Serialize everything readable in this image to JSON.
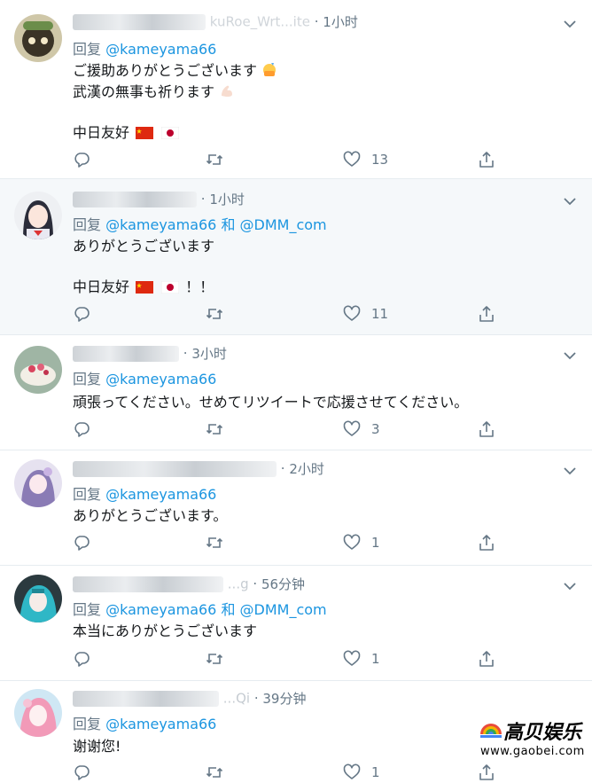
{
  "tweets": [
    {
      "name": "kuRoe_Wrt...ite",
      "time": "1小时",
      "reply_prefix": "回复",
      "mentions": "@kameyama66",
      "lines": [
        "ご援助ありがとうございます",
        "武漢の無事も祈ります",
        "",
        "中日友好"
      ],
      "likes": "13"
    },
    {
      "name": "...",
      "time": "1小时",
      "reply_prefix": "回复",
      "mentions": "@kameyama66 和 @DMM_com",
      "lines": [
        "ありがとうございます",
        "",
        "中日友好",
        "！！"
      ],
      "likes": "11"
    },
    {
      "name": "...",
      "time": "3小时",
      "reply_prefix": "回复",
      "mentions": "@kameyama66",
      "lines": [
        "頑張ってください。せめてリツイートで応援させてください。"
      ],
      "likes": "3"
    },
    {
      "name": "...",
      "time": "2小时",
      "reply_prefix": "回复",
      "mentions": "@kameyama66",
      "lines": [
        "ありがとうございます。"
      ],
      "likes": "1"
    },
    {
      "name": "...g",
      "time": "56分钟",
      "reply_prefix": "回复",
      "mentions": "@kameyama66 和 @DMM_com",
      "lines": [
        "本当にありがとうございます"
      ],
      "likes": "1"
    },
    {
      "name": "...Qi",
      "time": "39分钟",
      "reply_prefix": "回复",
      "mentions": "@kameyama66",
      "lines": [
        "谢谢您!"
      ],
      "likes": "1"
    }
  ],
  "watermark": {
    "title": "高贝娱乐",
    "url": "www.gaobei.com"
  },
  "colors": {
    "link": "#1b95e0",
    "muted": "#657786",
    "text": "#14171a",
    "highlight": "#f5f8fa",
    "divider": "#e6ecf0"
  },
  "icons": [
    "reply-icon",
    "retweet-icon",
    "like-icon",
    "share-icon",
    "caret-down-icon",
    "china-flag-icon",
    "japan-flag-icon"
  ]
}
